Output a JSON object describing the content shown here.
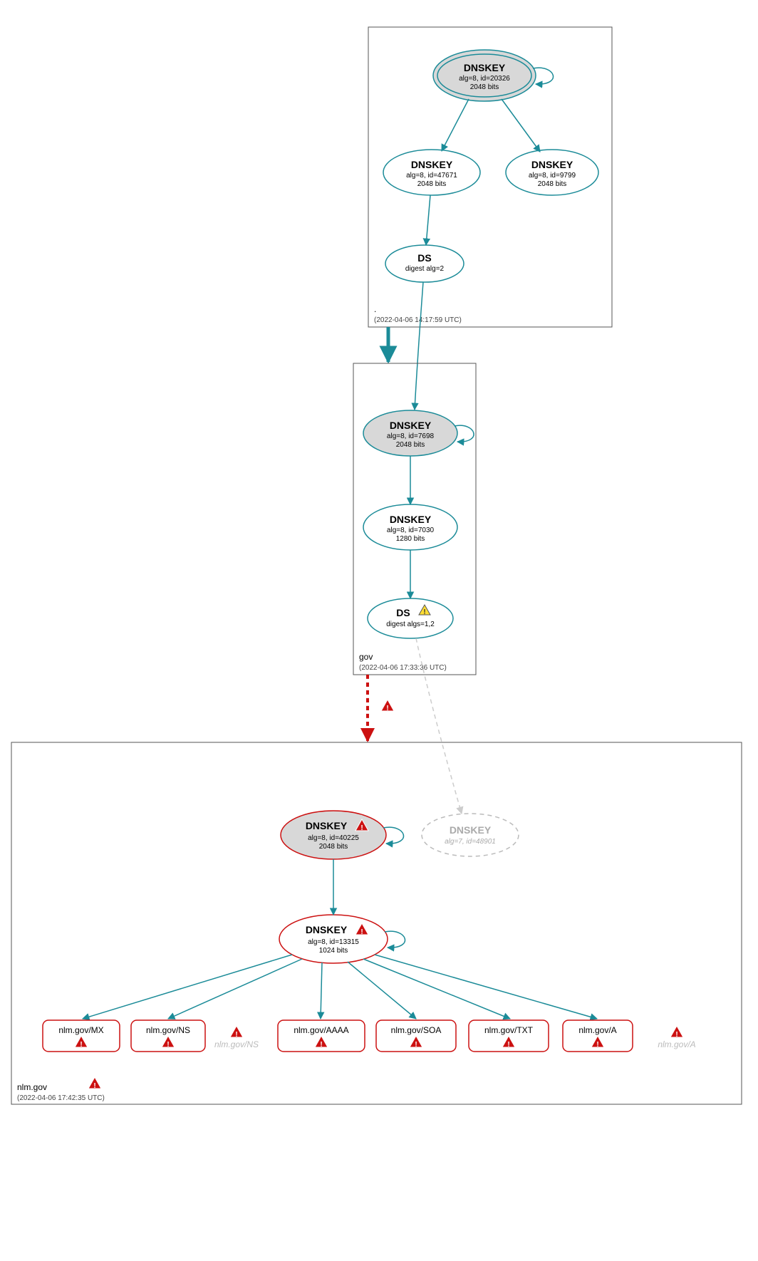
{
  "zones": {
    "root": {
      "name": ".",
      "time": "(2022-04-06 14:17:59 UTC)"
    },
    "gov": {
      "name": "gov",
      "time": "(2022-04-06 17:33:36 UTC)"
    },
    "nlm": {
      "name": "nlm.gov",
      "time": "(2022-04-06 17:42:35 UTC)"
    }
  },
  "nodes": {
    "root_ksk": {
      "title": "DNSKEY",
      "l1": "alg=8, id=20326",
      "l2": "2048 bits"
    },
    "root_zsk1": {
      "title": "DNSKEY",
      "l1": "alg=8, id=47671",
      "l2": "2048 bits"
    },
    "root_zsk2": {
      "title": "DNSKEY",
      "l1": "alg=8, id=9799",
      "l2": "2048 bits"
    },
    "root_ds": {
      "title": "DS",
      "l1": "digest alg=2",
      "l2": ""
    },
    "gov_ksk": {
      "title": "DNSKEY",
      "l1": "alg=8, id=7698",
      "l2": "2048 bits"
    },
    "gov_zsk": {
      "title": "DNSKEY",
      "l1": "alg=8, id=7030",
      "l2": "1280 bits"
    },
    "gov_ds": {
      "title": "DS",
      "l1": "digest algs=1,2",
      "l2": ""
    },
    "nlm_ksk": {
      "title": "DNSKEY",
      "l1": "alg=8, id=40225",
      "l2": "2048 bits"
    },
    "nlm_old": {
      "title": "DNSKEY",
      "l1": "alg=7, id=48901",
      "l2": ""
    },
    "nlm_zsk": {
      "title": "DNSKEY",
      "l1": "alg=8, id=13315",
      "l2": "1024 bits"
    }
  },
  "rr": {
    "mx": "nlm.gov/MX",
    "ns": "nlm.gov/NS",
    "ns_g": "nlm.gov/NS",
    "aaaa": "nlm.gov/AAAA",
    "soa": "nlm.gov/SOA",
    "txt": "nlm.gov/TXT",
    "a": "nlm.gov/A",
    "a_g": "nlm.gov/A"
  }
}
